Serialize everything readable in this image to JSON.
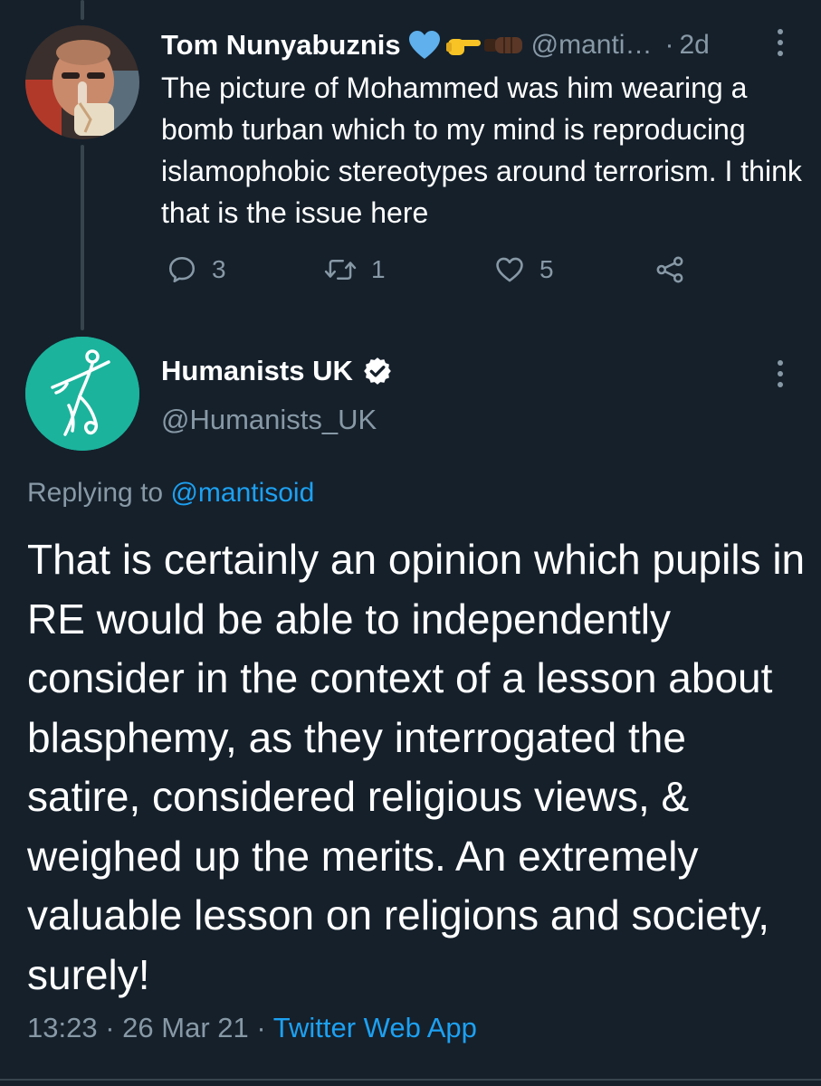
{
  "reply_tweet": {
    "author_name": "Tom Nunyabuznis",
    "author_handle": "@manti…",
    "separator": "·",
    "time": "2d",
    "text": "The picture of Mohammed was him wearing a bomb turban which to my mind is reproducing islamophobic stereotypes around terrorism.  I think that is the issue here",
    "name_emojis": [
      "blue-heart-icon",
      "pointing-hand-icon",
      "fist-icon"
    ],
    "actions": {
      "reply_count": "3",
      "retweet_count": "1",
      "like_count": "5"
    }
  },
  "main_tweet": {
    "author_name": "Humanists UK",
    "author_handle": "@Humanists_UK",
    "verified": true,
    "replying_prefix": "Replying to",
    "replying_to": "@mantisoid",
    "text": "That is certainly an opinion which pupils in RE would be able to independently consider in the context of a lesson about blasphemy, as they interrogated the satire, considered religious views, & weighed up the merits. An extremely valuable lesson on religions and society, surely!",
    "time": "13:23",
    "separator_1": "·",
    "date": "26 Mar 21",
    "separator_2": "·",
    "source": "Twitter Web App"
  },
  "colors": {
    "background": "#15202b",
    "text_primary": "#ffffff",
    "text_secondary": "#8899a6",
    "link": "#1da1f2",
    "divider": "#38444d",
    "humanists_avatar": "#1bb39c"
  }
}
